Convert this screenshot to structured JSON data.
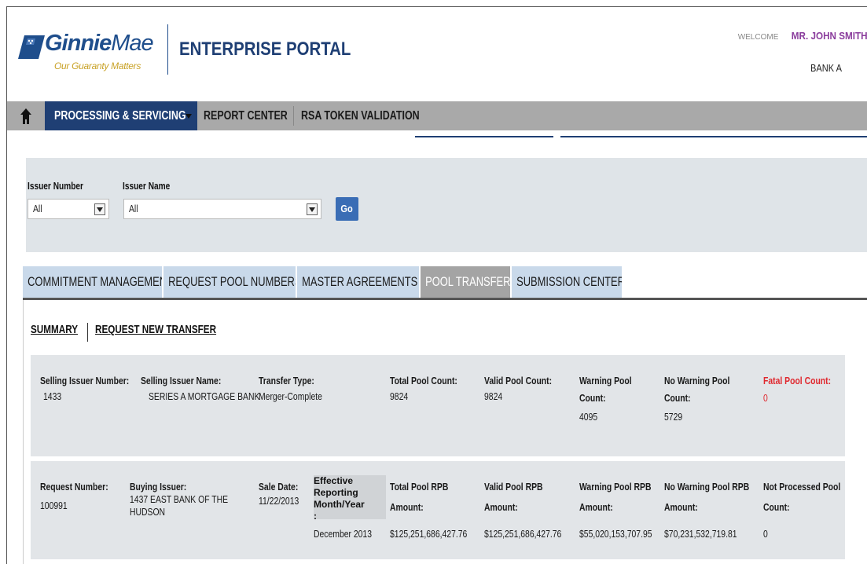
{
  "header": {
    "logo_name_bold": "Ginnie",
    "logo_name_light": "Mae",
    "logo_tagline": "Our Guaranty Matters",
    "portal_title": "ENTERPRISE PORTAL",
    "welcome_label": "WELCOME",
    "user_name": "MR. JOHN SMITH",
    "bank_name": "BANK A"
  },
  "nav": {
    "items": [
      {
        "label": "PROCESSING & SERVICING",
        "active": true
      },
      {
        "label": "REPORT CENTER",
        "active": false
      },
      {
        "label": "RSA TOKEN VALIDATION",
        "active": false
      }
    ]
  },
  "filter": {
    "issuer_number_label": "Issuer Number",
    "issuer_number_value": "All",
    "issuer_name_label": "Issuer Name",
    "issuer_name_value": "All",
    "go_label": "Go"
  },
  "tabs": [
    {
      "label": "COMMITMENT MANAGEMENT",
      "active": false
    },
    {
      "label": "REQUEST POOL NUMBERS",
      "active": false
    },
    {
      "label": "MASTER AGREEMENTS",
      "active": false
    },
    {
      "label": "POOL TRANSFER",
      "active": true
    },
    {
      "label": "SUBMISSION CENTER",
      "active": false
    }
  ],
  "subnav": {
    "summary": "SUMMARY",
    "request_new_transfer": "REQUEST NEW TRANSFER"
  },
  "summary": {
    "selling_issuer_number": {
      "label": "Selling Issuer Number:",
      "value": "1433"
    },
    "selling_issuer_name": {
      "label": "Selling Issuer Name:",
      "value": "SERIES A MORTGAGE BANK"
    },
    "transfer_type": {
      "label": "Transfer Type:",
      "value": "Merger-Complete"
    },
    "total_pool_count": {
      "label": "Total Pool Count:",
      "value": "9824"
    },
    "valid_pool_count": {
      "label": "Valid Pool Count:",
      "value": "9824"
    },
    "warning_pool_count": {
      "label1": "Warning Pool",
      "label2": "Count:",
      "value": "4095"
    },
    "no_warning_pool_count": {
      "label1": "No Warning Pool",
      "label2": "Count:",
      "value": "5729"
    },
    "fatal_pool_count": {
      "label": "Fatal Pool Count:",
      "value": "0"
    }
  },
  "request": {
    "request_number": {
      "label": "Request Number:",
      "value": "100991"
    },
    "buying_issuer": {
      "label": "Buying Issuer:",
      "value1": "1437 EAST BANK OF THE",
      "value2": "HUDSON"
    },
    "sale_date": {
      "label": "Sale Date:",
      "value": "11/22/2013"
    },
    "effective_reporting": {
      "label1": "Effective",
      "label2": "Reporting",
      "label3": "Month/Year",
      "label4": ":",
      "value": "December 2013"
    },
    "total_pool_rpb": {
      "label1": "Total Pool RPB",
      "label2": "Amount:",
      "value": "$125,251,686,427.76"
    },
    "valid_pool_rpb": {
      "label1": "Valid Pool RPB",
      "label2": "Amount:",
      "value": "$125,251,686,427.76"
    },
    "warning_pool_rpb": {
      "label1": "Warning Pool RPB",
      "label2": "Amount:",
      "value": "$55,020,153,707.95"
    },
    "no_warning_pool_rpb": {
      "label1": "No Warning Pool RPB",
      "label2": "Amount:",
      "value": "$70,231,532,719.81"
    },
    "not_processed_pool": {
      "label1": "Not Processed Pool",
      "label2": "Count:",
      "value": "0"
    }
  },
  "colors": {
    "nav_active": "#1f3f74",
    "navbar_bg": "#a9a9a9",
    "tab_bg": "#c9d9ea",
    "tab_active": "#a4a4a4",
    "panel_bg": "#dfe4e8",
    "go_button": "#3a6db5",
    "user_name": "#8a3c9c",
    "fatal_red": "#e0282e"
  }
}
